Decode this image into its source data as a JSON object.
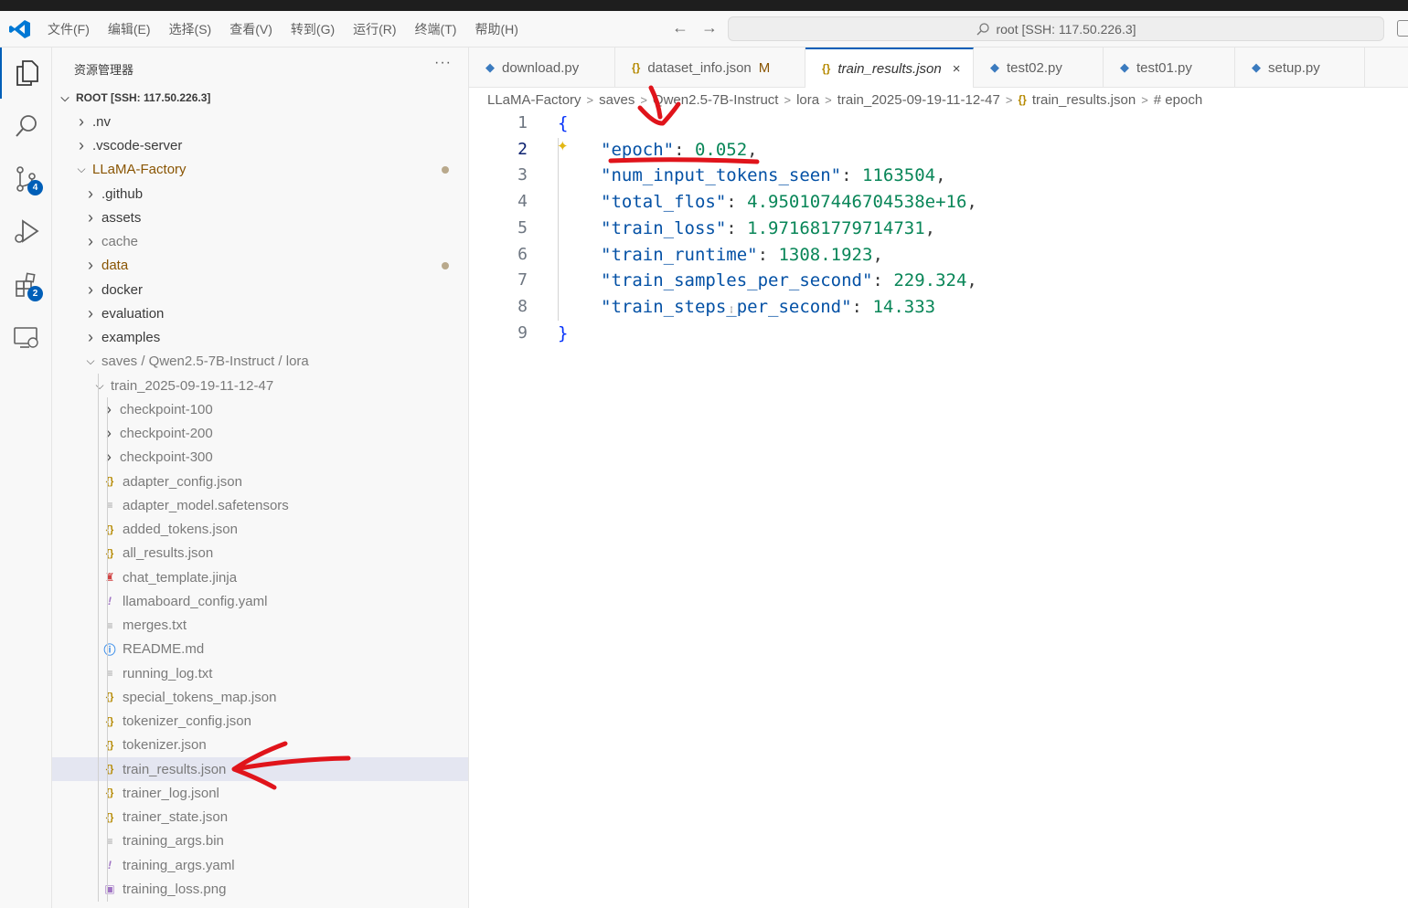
{
  "menu": [
    "文件(F)",
    "编辑(E)",
    "选择(S)",
    "查看(V)",
    "转到(G)",
    "运行(R)",
    "终端(T)",
    "帮助(H)"
  ],
  "nav": {
    "back": "←",
    "forward": "→"
  },
  "command_center": "root [SSH: 117.50.226.3]",
  "activity_badges": {
    "source_control": "4",
    "extensions": "2"
  },
  "explorer": {
    "title": "资源管理器",
    "more": "···",
    "root": "ROOT [SSH: 117.50.226.3]",
    "items": [
      {
        "label": ".nv",
        "kind": "folder",
        "indent": 1,
        "open": false
      },
      {
        "label": ".vscode-server",
        "kind": "folder",
        "indent": 1,
        "open": false
      },
      {
        "label": "LLaMA-Factory",
        "kind": "folder",
        "indent": 1,
        "open": true,
        "modified": true
      },
      {
        "label": ".github",
        "kind": "folder",
        "indent": 2,
        "open": false
      },
      {
        "label": "assets",
        "kind": "folder",
        "indent": 2,
        "open": false
      },
      {
        "label": "cache",
        "kind": "folder",
        "indent": 2,
        "open": false,
        "dim": true
      },
      {
        "label": "data",
        "kind": "folder",
        "indent": 2,
        "open": false,
        "modified": true
      },
      {
        "label": "docker",
        "kind": "folder",
        "indent": 2,
        "open": false
      },
      {
        "label": "evaluation",
        "kind": "folder",
        "indent": 2,
        "open": false
      },
      {
        "label": "examples",
        "kind": "folder",
        "indent": 2,
        "open": false
      },
      {
        "label": "saves / Qwen2.5-7B-Instruct / lora",
        "kind": "folder",
        "indent": 2,
        "open": true,
        "dim": true
      },
      {
        "label": "train_2025-09-19-11-12-47",
        "kind": "folder",
        "indent": 3,
        "open": true,
        "dim": true
      },
      {
        "label": "checkpoint-100",
        "kind": "folder",
        "indent": 4,
        "open": false,
        "dim": true
      },
      {
        "label": "checkpoint-200",
        "kind": "folder",
        "indent": 4,
        "open": false,
        "dim": true
      },
      {
        "label": "checkpoint-300",
        "kind": "folder",
        "indent": 4,
        "open": false,
        "dim": true
      },
      {
        "label": "adapter_config.json",
        "kind": "json",
        "indent": 4,
        "dim": true
      },
      {
        "label": "adapter_model.safetensors",
        "kind": "txt",
        "indent": 4,
        "dim": true
      },
      {
        "label": "added_tokens.json",
        "kind": "json",
        "indent": 4,
        "dim": true
      },
      {
        "label": "all_results.json",
        "kind": "json",
        "indent": 4,
        "dim": true
      },
      {
        "label": "chat_template.jinja",
        "kind": "jinja",
        "indent": 4,
        "dim": true
      },
      {
        "label": "llamaboard_config.yaml",
        "kind": "yaml",
        "indent": 4,
        "dim": true
      },
      {
        "label": "merges.txt",
        "kind": "txt",
        "indent": 4,
        "dim": true
      },
      {
        "label": "README.md",
        "kind": "md",
        "indent": 4,
        "dim": true
      },
      {
        "label": "running_log.txt",
        "kind": "txt",
        "indent": 4,
        "dim": true
      },
      {
        "label": "special_tokens_map.json",
        "kind": "json",
        "indent": 4,
        "dim": true
      },
      {
        "label": "tokenizer_config.json",
        "kind": "json",
        "indent": 4,
        "dim": true
      },
      {
        "label": "tokenizer.json",
        "kind": "json",
        "indent": 4,
        "dim": true
      },
      {
        "label": "train_results.json",
        "kind": "json",
        "indent": 4,
        "dim": true,
        "selected": true
      },
      {
        "label": "trainer_log.jsonl",
        "kind": "json",
        "indent": 4,
        "dim": true
      },
      {
        "label": "trainer_state.json",
        "kind": "json",
        "indent": 4,
        "dim": true
      },
      {
        "label": "training_args.bin",
        "kind": "txt",
        "indent": 4,
        "dim": true
      },
      {
        "label": "training_args.yaml",
        "kind": "yaml",
        "indent": 4,
        "dim": true
      },
      {
        "label": "training_loss.png",
        "kind": "png",
        "indent": 4,
        "dim": true
      }
    ]
  },
  "tabs": [
    {
      "label": "download.py",
      "icon": "python-icon"
    },
    {
      "label": "dataset_info.json",
      "icon": "json-icon",
      "modified": "M"
    },
    {
      "label": "train_results.json",
      "icon": "json-icon",
      "active": true,
      "close": "×"
    },
    {
      "label": "test02.py",
      "icon": "python-icon"
    },
    {
      "label": "test01.py",
      "icon": "python-icon"
    },
    {
      "label": "setup.py",
      "icon": "python-icon"
    }
  ],
  "breadcrumb": [
    "LLaMA-Factory",
    "saves",
    "Qwen2.5-7B-Instruct",
    "lora",
    "train_2025-09-19-11-12-47",
    "train_results.json",
    "# epoch"
  ],
  "editor": {
    "current_line": 2,
    "lines": [
      {
        "n": "1",
        "open": "{"
      },
      {
        "n": "2",
        "key": "\"epoch\"",
        "value": "0.052",
        "comma": ","
      },
      {
        "n": "3",
        "key": "\"num_input_tokens_seen\"",
        "value": "1163504",
        "comma": ","
      },
      {
        "n": "4",
        "key": "\"total_flos\"",
        "value": "4.950107446704538e+16",
        "comma": ","
      },
      {
        "n": "5",
        "key": "\"train_loss\"",
        "value": "1.971681779714731",
        "comma": ","
      },
      {
        "n": "6",
        "key": "\"train_runtime\"",
        "value": "1308.1923",
        "comma": ","
      },
      {
        "n": "7",
        "key": "\"train_samples_per_second\"",
        "value": "229.324",
        "comma": ","
      },
      {
        "n": "8",
        "key": "\"train_steps_per_second\"",
        "value": "14.333",
        "comma": ""
      },
      {
        "n": "9",
        "close": "}"
      }
    ]
  },
  "colors": {
    "accent": "#005fb8",
    "annotation": "#e0141b",
    "json_key": "#0451a5",
    "json_number": "#098658"
  }
}
